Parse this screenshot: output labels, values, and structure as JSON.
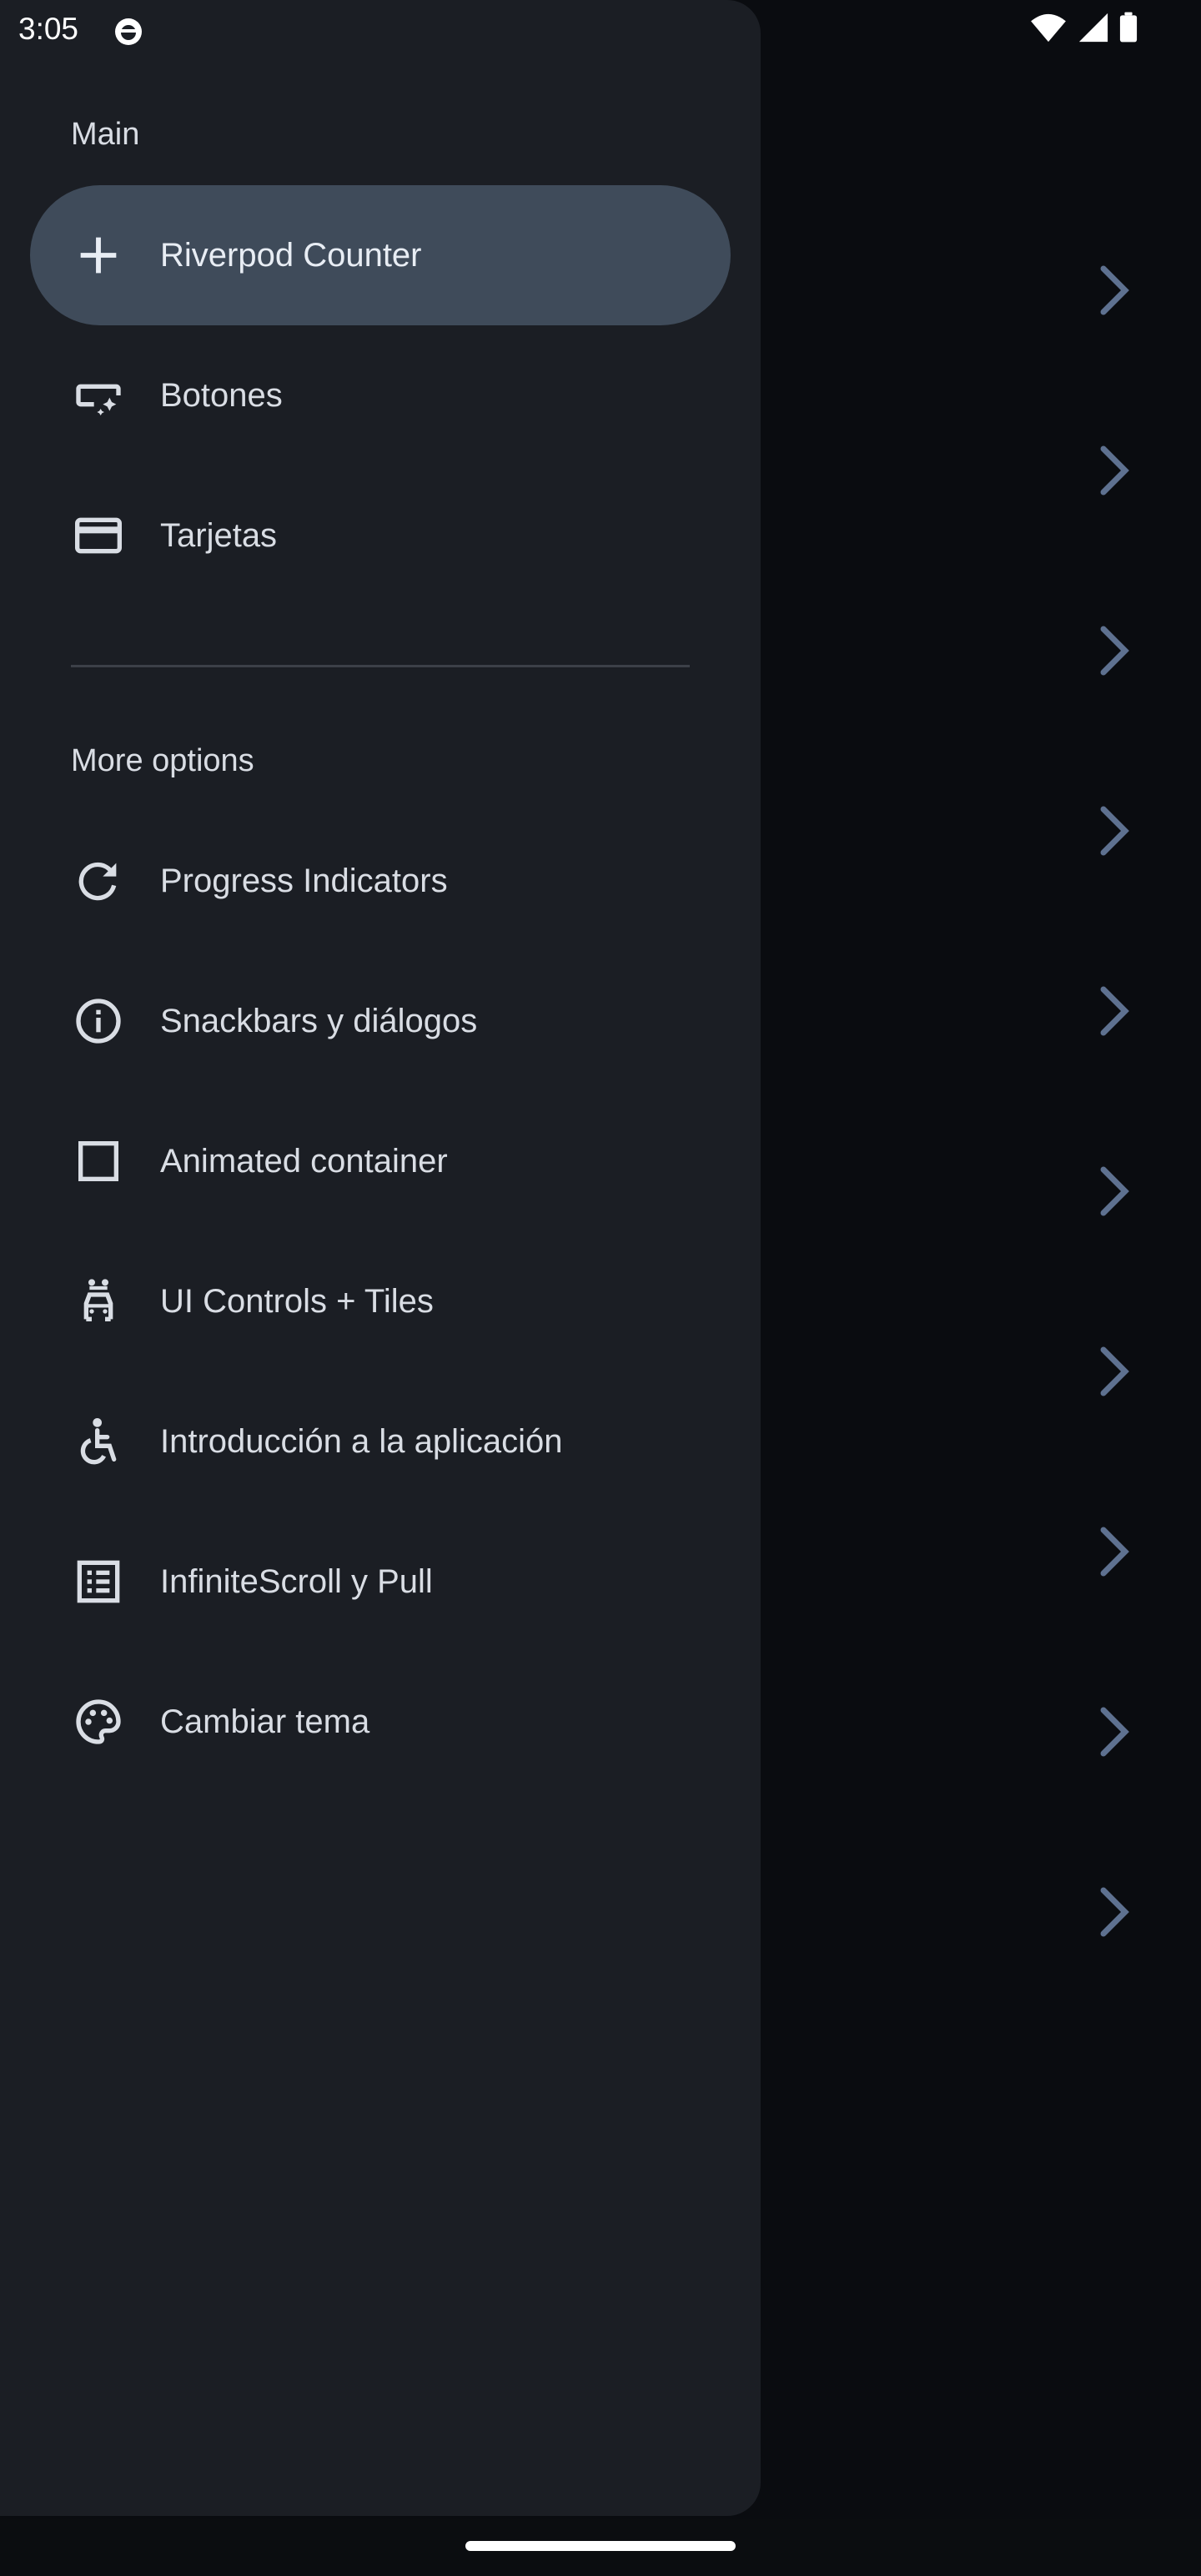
{
  "status_bar": {
    "time": "3:05",
    "icons": [
      "app-notification-icon",
      "wifi-icon",
      "signal-icon",
      "battery-icon"
    ]
  },
  "drawer": {
    "sections": [
      {
        "label": "Main",
        "items": [
          {
            "label": "Riverpod Counter",
            "icon": "add-icon",
            "selected": true
          },
          {
            "label": "Botones",
            "icon": "smart-button-icon",
            "selected": false
          },
          {
            "label": "Tarjetas",
            "icon": "credit-card-icon",
            "selected": false
          }
        ]
      },
      {
        "label": "More options",
        "items": [
          {
            "label": "Progress Indicators",
            "icon": "refresh-icon"
          },
          {
            "label": "Snackbars y diálogos",
            "icon": "info-icon"
          },
          {
            "label": "Animated container",
            "icon": "square-outline-icon"
          },
          {
            "label": "UI Controls + Tiles",
            "icon": "car-rental-icon"
          },
          {
            "label": "Introducción a la aplicación",
            "icon": "accessible-icon"
          },
          {
            "label": "InfiniteScroll y Pull",
            "icon": "list-alt-icon"
          },
          {
            "label": "Cambiar tema",
            "icon": "palette-icon"
          }
        ]
      }
    ]
  },
  "background": {
    "chevron_count": 10,
    "chevron_color": "#5e7190"
  },
  "colors": {
    "drawer_bg": "#1b1e24",
    "selected_bg": "#3f4b5a",
    "text": "#d9dde4"
  }
}
